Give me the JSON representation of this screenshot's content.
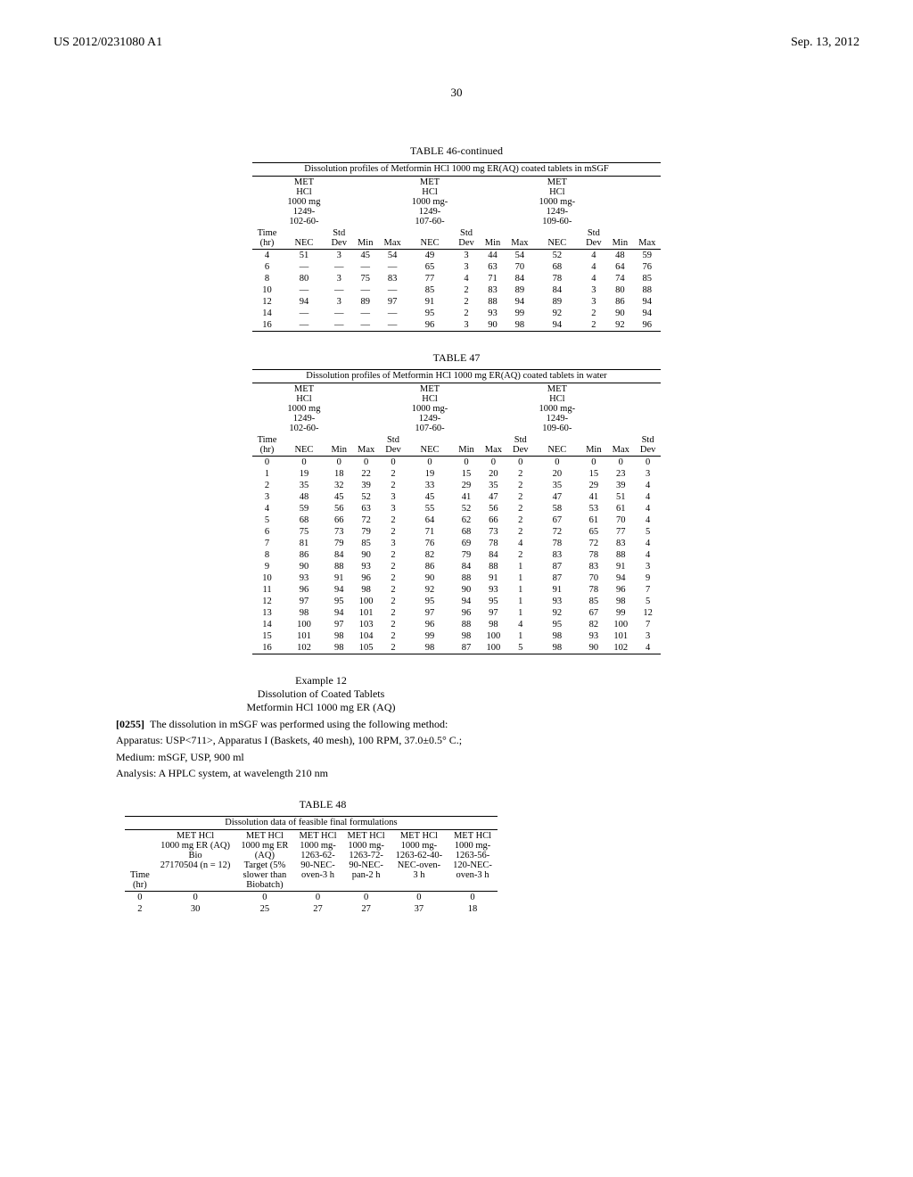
{
  "header": {
    "left": "US 2012/0231080 A1",
    "right": "Sep. 13, 2012"
  },
  "page_number": "30",
  "table46": {
    "title": "TABLE 46-continued",
    "caption": "Dissolution profiles of Metformin HCl 1000 mg ER(AQ) coated tablets in mSGF",
    "col_group1": "MET HCl 1000 mg 1249-102-60-NEC",
    "col_group2": "MET HCl 1000 mg-1249-107-60-NEC",
    "col_group3": "MET HCl 1000 mg-1249-109-60-NEC",
    "h_time": "Time (hr)",
    "h_std": "Std Dev",
    "h_min": "Min",
    "h_max": "Max",
    "rows": [
      [
        "4",
        "51",
        "3",
        "45",
        "54",
        "49",
        "3",
        "44",
        "54",
        "52",
        "4",
        "48",
        "59"
      ],
      [
        "6",
        "—",
        "—",
        "—",
        "—",
        "65",
        "3",
        "63",
        "70",
        "68",
        "4",
        "64",
        "76"
      ],
      [
        "8",
        "80",
        "3",
        "75",
        "83",
        "77",
        "4",
        "71",
        "84",
        "78",
        "4",
        "74",
        "85"
      ],
      [
        "10",
        "—",
        "—",
        "—",
        "—",
        "85",
        "2",
        "83",
        "89",
        "84",
        "3",
        "80",
        "88"
      ],
      [
        "12",
        "94",
        "3",
        "89",
        "97",
        "91",
        "2",
        "88",
        "94",
        "89",
        "3",
        "86",
        "94"
      ],
      [
        "14",
        "—",
        "—",
        "—",
        "—",
        "95",
        "2",
        "93",
        "99",
        "92",
        "2",
        "90",
        "94"
      ],
      [
        "16",
        "—",
        "—",
        "—",
        "—",
        "96",
        "3",
        "90",
        "98",
        "94",
        "2",
        "92",
        "96"
      ]
    ]
  },
  "table47": {
    "title": "TABLE 47",
    "caption": "Dissolution profiles of Metformin HCl 1000 mg ER(AQ) coated tablets in water",
    "rows": [
      [
        "0",
        "0",
        "0",
        "0",
        "0",
        "0",
        "0",
        "0",
        "0",
        "0",
        "0",
        "0",
        "0"
      ],
      [
        "1",
        "19",
        "18",
        "22",
        "2",
        "19",
        "15",
        "20",
        "2",
        "20",
        "15",
        "23",
        "3"
      ],
      [
        "2",
        "35",
        "32",
        "39",
        "2",
        "33",
        "29",
        "35",
        "2",
        "35",
        "29",
        "39",
        "4"
      ],
      [
        "3",
        "48",
        "45",
        "52",
        "3",
        "45",
        "41",
        "47",
        "2",
        "47",
        "41",
        "51",
        "4"
      ],
      [
        "4",
        "59",
        "56",
        "63",
        "3",
        "55",
        "52",
        "56",
        "2",
        "58",
        "53",
        "61",
        "4"
      ],
      [
        "5",
        "68",
        "66",
        "72",
        "2",
        "64",
        "62",
        "66",
        "2",
        "67",
        "61",
        "70",
        "4"
      ],
      [
        "6",
        "75",
        "73",
        "79",
        "2",
        "71",
        "68",
        "73",
        "2",
        "72",
        "65",
        "77",
        "5"
      ],
      [
        "7",
        "81",
        "79",
        "85",
        "3",
        "76",
        "69",
        "78",
        "4",
        "78",
        "72",
        "83",
        "4"
      ],
      [
        "8",
        "86",
        "84",
        "90",
        "2",
        "82",
        "79",
        "84",
        "2",
        "83",
        "78",
        "88",
        "4"
      ],
      [
        "9",
        "90",
        "88",
        "93",
        "2",
        "86",
        "84",
        "88",
        "1",
        "87",
        "83",
        "91",
        "3"
      ],
      [
        "10",
        "93",
        "91",
        "96",
        "2",
        "90",
        "88",
        "91",
        "1",
        "87",
        "70",
        "94",
        "9"
      ],
      [
        "11",
        "96",
        "94",
        "98",
        "2",
        "92",
        "90",
        "93",
        "1",
        "91",
        "78",
        "96",
        "7"
      ],
      [
        "12",
        "97",
        "95",
        "100",
        "2",
        "95",
        "94",
        "95",
        "1",
        "93",
        "85",
        "98",
        "5"
      ],
      [
        "13",
        "98",
        "94",
        "101",
        "2",
        "97",
        "96",
        "97",
        "1",
        "92",
        "67",
        "99",
        "12"
      ],
      [
        "14",
        "100",
        "97",
        "103",
        "2",
        "96",
        "88",
        "98",
        "4",
        "95",
        "82",
        "100",
        "7"
      ],
      [
        "15",
        "101",
        "98",
        "104",
        "2",
        "99",
        "98",
        "100",
        "1",
        "98",
        "93",
        "101",
        "3"
      ],
      [
        "16",
        "102",
        "98",
        "105",
        "2",
        "98",
        "87",
        "100",
        "5",
        "98",
        "90",
        "102",
        "4"
      ]
    ]
  },
  "example": {
    "title": "Example 12",
    "sub1": "Dissolution of Coated Tablets",
    "sub2": "Metformin HCl 1000 mg ER (AQ)",
    "para_num": "[0255]",
    "para_text": "The dissolution in mSGF was performed using the following method:",
    "line1": "Apparatus: USP<711>, Apparatus I (Baskets, 40 mesh), 100 RPM, 37.0±0.5° C.;",
    "line2": "Medium: mSGF, USP, 900 ml",
    "line3": "Analysis: A HPLC system, at wavelength 210 nm"
  },
  "table48": {
    "title": "TABLE 48",
    "caption": "Dissolution data of feasible final formulations",
    "h_time": "Time (hr)",
    "h1": "MET HCl 1000 mg ER (AQ) Bio 27170504 (n = 12)",
    "h2": "MET HCl 1000 mg ER (AQ) Target (5% slower than Biobatch)",
    "h3": "MET HCl 1000 mg-1263-62-90-NEC-oven-3 h",
    "h4": "MET HCl 1000 mg-1263-72-90-NEC-pan-2 h",
    "h5": "MET HCl 1000 mg-1263-62-40-NEC-oven-3 h",
    "h6": "MET HCl 1000 mg-1263-56-120-NEC-oven-3 h",
    "rows": [
      [
        "0",
        "0",
        "0",
        "0",
        "0",
        "0",
        "0"
      ],
      [
        "2",
        "30",
        "25",
        "27",
        "27",
        "37",
        "18"
      ]
    ]
  },
  "chart_data": [
    {
      "type": "table",
      "title": "TABLE 46-continued — Dissolution profiles of Metformin HCl 1000 mg ER(AQ) coated tablets in mSGF",
      "columns": [
        "Time (hr)",
        "NEC 102-60 Mean",
        "NEC 102-60 Std Dev",
        "NEC 102-60 Min",
        "NEC 102-60 Max",
        "NEC 107-60 Mean",
        "NEC 107-60 Std Dev",
        "NEC 107-60 Min",
        "NEC 107-60 Max",
        "NEC 109-60 Mean",
        "NEC 109-60 Std Dev",
        "NEC 109-60 Min",
        "NEC 109-60 Max"
      ],
      "rows": [
        [
          4,
          51,
          3,
          45,
          54,
          49,
          3,
          44,
          54,
          52,
          4,
          48,
          59
        ],
        [
          6,
          null,
          null,
          null,
          null,
          65,
          3,
          63,
          70,
          68,
          4,
          64,
          76
        ],
        [
          8,
          80,
          3,
          75,
          83,
          77,
          4,
          71,
          84,
          78,
          4,
          74,
          85
        ],
        [
          10,
          null,
          null,
          null,
          null,
          85,
          2,
          83,
          89,
          84,
          3,
          80,
          88
        ],
        [
          12,
          94,
          3,
          89,
          97,
          91,
          2,
          88,
          94,
          89,
          3,
          86,
          94
        ],
        [
          14,
          null,
          null,
          null,
          null,
          95,
          2,
          93,
          99,
          92,
          2,
          90,
          94
        ],
        [
          16,
          null,
          null,
          null,
          null,
          96,
          3,
          90,
          98,
          94,
          2,
          92,
          96
        ]
      ]
    },
    {
      "type": "table",
      "title": "TABLE 47 — Dissolution profiles of Metformin HCl 1000 mg ER(AQ) coated tablets in water",
      "columns": [
        "Time (hr)",
        "NEC 102-60 Mean",
        "NEC 102-60 Min",
        "NEC 102-60 Max",
        "NEC 102-60 Std Dev",
        "NEC 107-60 Mean",
        "NEC 107-60 Min",
        "NEC 107-60 Max",
        "NEC 107-60 Std Dev",
        "NEC 109-60 Mean",
        "NEC 109-60 Min",
        "NEC 109-60 Max",
        "NEC 109-60 Std Dev"
      ],
      "rows": [
        [
          0,
          0,
          0,
          0,
          0,
          0,
          0,
          0,
          0,
          0,
          0,
          0,
          0
        ],
        [
          1,
          19,
          18,
          22,
          2,
          19,
          15,
          20,
          2,
          20,
          15,
          23,
          3
        ],
        [
          2,
          35,
          32,
          39,
          2,
          33,
          29,
          35,
          2,
          35,
          29,
          39,
          4
        ],
        [
          3,
          48,
          45,
          52,
          3,
          45,
          41,
          47,
          2,
          47,
          41,
          51,
          4
        ],
        [
          4,
          59,
          56,
          63,
          3,
          55,
          52,
          56,
          2,
          58,
          53,
          61,
          4
        ],
        [
          5,
          68,
          66,
          72,
          2,
          64,
          62,
          66,
          2,
          67,
          61,
          70,
          4
        ],
        [
          6,
          75,
          73,
          79,
          2,
          71,
          68,
          73,
          2,
          72,
          65,
          77,
          5
        ],
        [
          7,
          81,
          79,
          85,
          3,
          76,
          69,
          78,
          4,
          78,
          72,
          83,
          4
        ],
        [
          8,
          86,
          84,
          90,
          2,
          82,
          79,
          84,
          2,
          83,
          78,
          88,
          4
        ],
        [
          9,
          90,
          88,
          93,
          2,
          86,
          84,
          88,
          1,
          87,
          83,
          91,
          3
        ],
        [
          10,
          93,
          91,
          96,
          2,
          90,
          88,
          91,
          1,
          87,
          70,
          94,
          9
        ],
        [
          11,
          96,
          94,
          98,
          2,
          92,
          90,
          93,
          1,
          91,
          78,
          96,
          7
        ],
        [
          12,
          97,
          95,
          100,
          2,
          95,
          94,
          95,
          1,
          93,
          85,
          98,
          5
        ],
        [
          13,
          98,
          94,
          101,
          2,
          97,
          96,
          97,
          1,
          92,
          67,
          99,
          12
        ],
        [
          14,
          100,
          97,
          103,
          2,
          96,
          88,
          98,
          4,
          95,
          82,
          100,
          7
        ],
        [
          15,
          101,
          98,
          104,
          2,
          99,
          98,
          100,
          1,
          98,
          93,
          101,
          3
        ],
        [
          16,
          102,
          98,
          105,
          2,
          98,
          87,
          100,
          5,
          98,
          90,
          102,
          4
        ]
      ]
    },
    {
      "type": "table",
      "title": "TABLE 48 — Dissolution data of feasible final formulations",
      "columns": [
        "Time (hr)",
        "Bio 27170504 (n=12)",
        "Target (5% slower than Biobatch)",
        "1263-62-90-NEC-oven-3 h",
        "1263-72-90-NEC-pan-2 h",
        "1263-62-40-NEC-oven-3 h",
        "1263-56-120-NEC-oven-3 h"
      ],
      "rows": [
        [
          0,
          0,
          0,
          0,
          0,
          0,
          0
        ],
        [
          2,
          30,
          25,
          27,
          27,
          37,
          18
        ]
      ]
    }
  ]
}
